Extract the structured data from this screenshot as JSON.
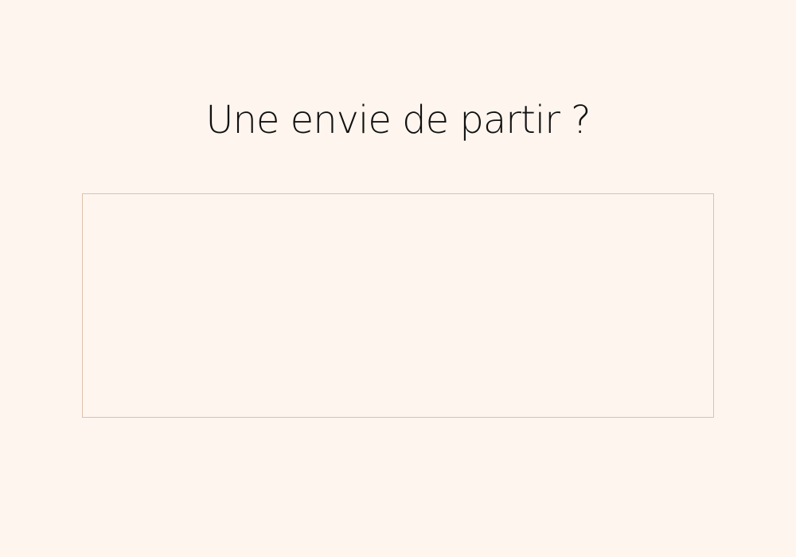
{
  "heading": {
    "title": "Une envie de partir ?"
  },
  "colors": {
    "background": "#FEF5EE",
    "title_text": "#111111",
    "frame_border": "#DCC2AC"
  }
}
